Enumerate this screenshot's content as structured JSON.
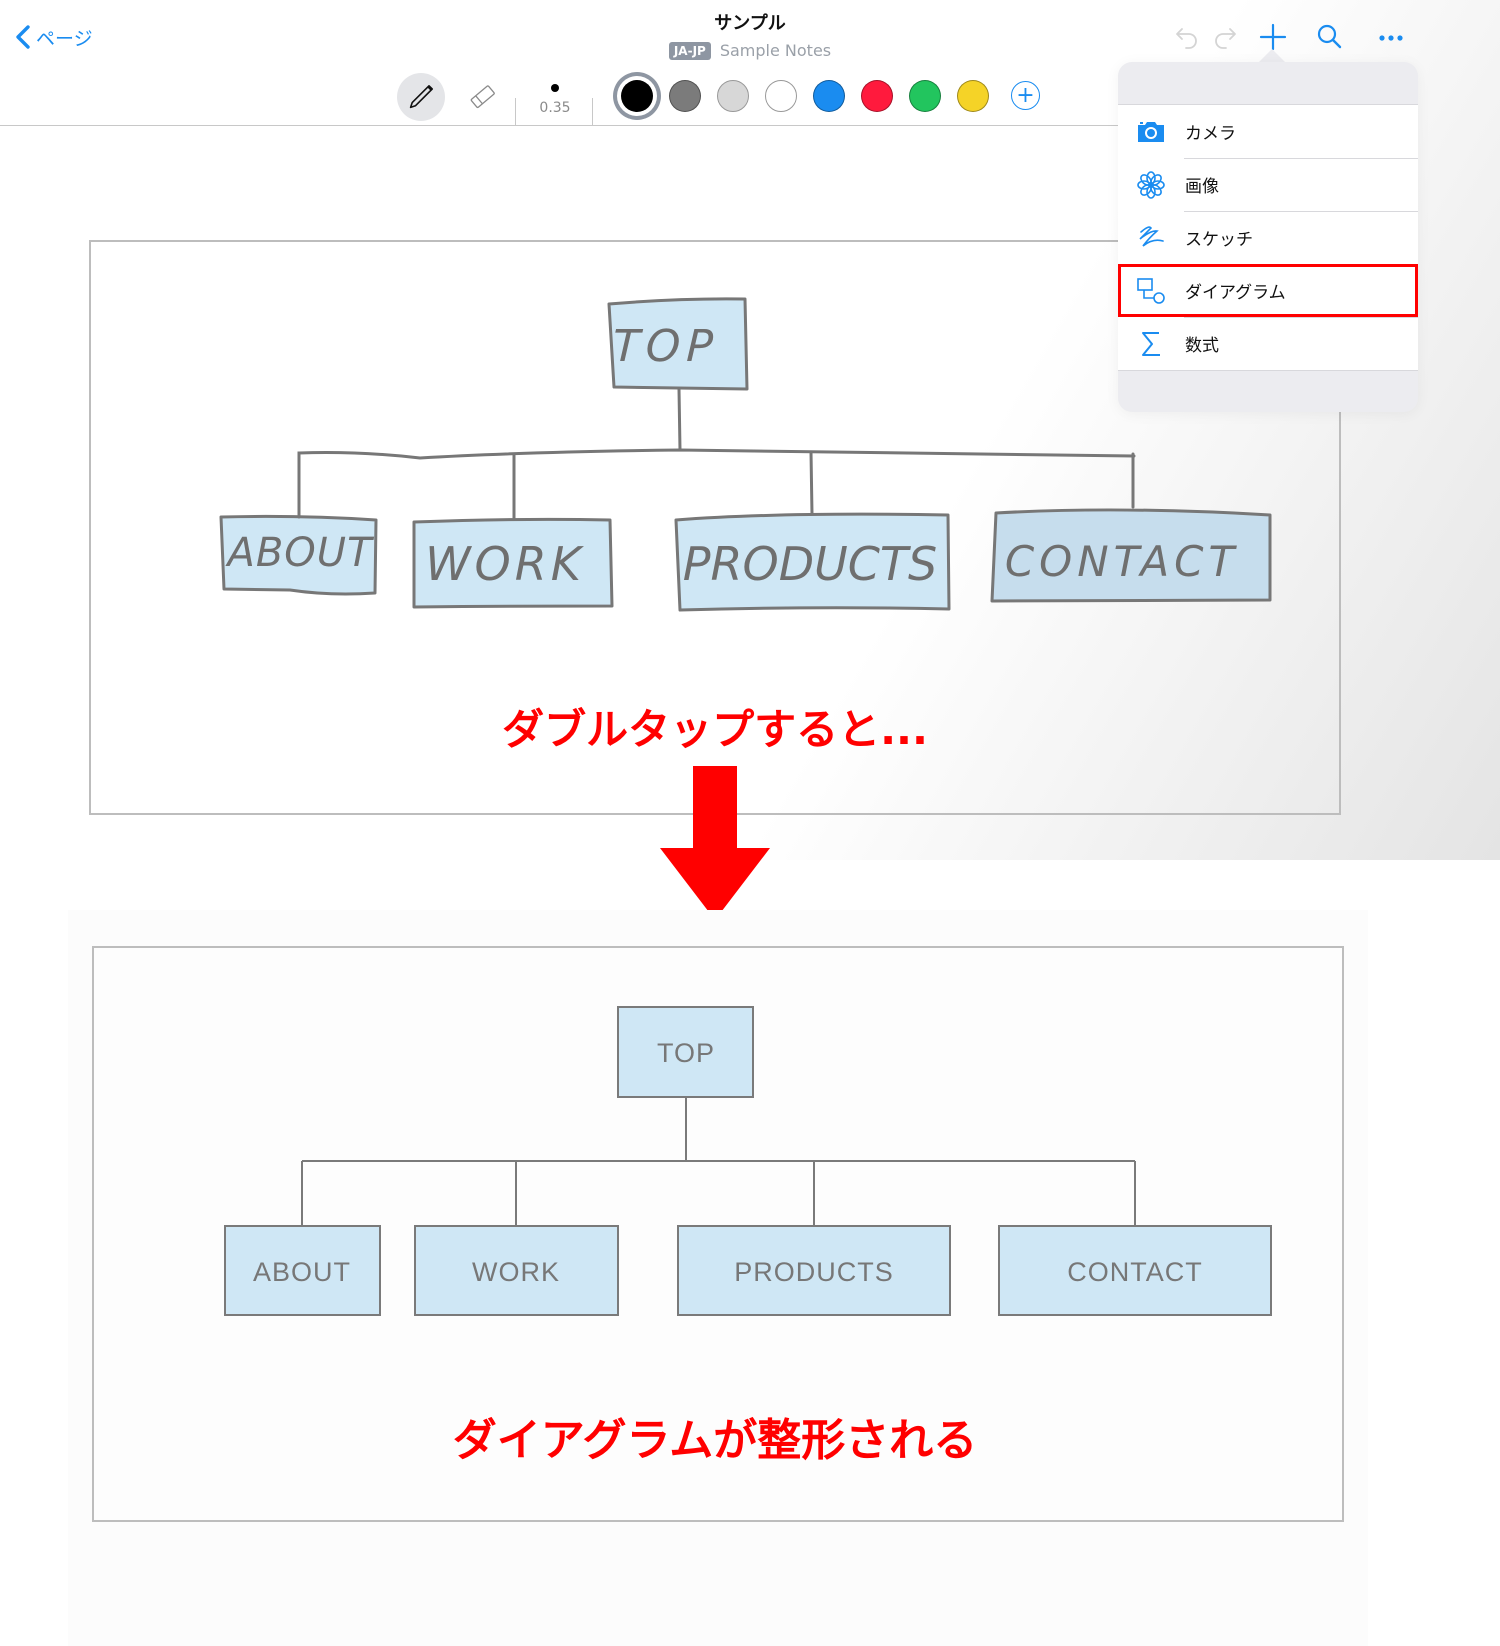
{
  "header": {
    "back_label": "ページ",
    "title": "サンプル",
    "language_badge": "JA-JP",
    "notebook_name": "Sample Notes"
  },
  "top_actions": {
    "undo": "undo-icon",
    "redo": "redo-icon",
    "add": "plus-icon",
    "search": "search-icon",
    "more": "ellipsis-icon"
  },
  "toolbar": {
    "tools": [
      {
        "name": "pencil",
        "icon": "pencil-icon",
        "selected": true
      },
      {
        "name": "eraser",
        "icon": "eraser-icon",
        "selected": false
      }
    ],
    "pen_size": "0.35",
    "colors": [
      {
        "name": "black",
        "hex": "#000000",
        "selected": true
      },
      {
        "name": "gray",
        "hex": "#7b7b7b",
        "selected": false
      },
      {
        "name": "light-gray",
        "hex": "#d7d7d7",
        "selected": false
      },
      {
        "name": "white",
        "hex": "#ffffff",
        "selected": false
      },
      {
        "name": "blue",
        "hex": "#1a8cf0",
        "selected": false
      },
      {
        "name": "red",
        "hex": "#ff1a3d",
        "selected": false
      },
      {
        "name": "green",
        "hex": "#22c55e",
        "selected": false
      },
      {
        "name": "yellow",
        "hex": "#f5d327",
        "selected": false
      }
    ],
    "add_color_label": "+"
  },
  "insert_menu": {
    "items": [
      {
        "label": "カメラ",
        "icon": "camera-icon",
        "highlighted": false
      },
      {
        "label": "画像",
        "icon": "photos-flower-icon",
        "highlighted": false
      },
      {
        "label": "スケッチ",
        "icon": "sketch-squiggle-icon",
        "highlighted": false
      },
      {
        "label": "ダイアグラム",
        "icon": "diagram-shapes-icon",
        "highlighted": true
      },
      {
        "label": "数式",
        "icon": "sigma-icon",
        "highlighted": false
      }
    ]
  },
  "diagram": {
    "root": "TOP",
    "children": [
      "ABOUT",
      "WORK",
      "PRODUCTS",
      "CONTACT"
    ]
  },
  "captions": {
    "before": "ダブルタップすると...",
    "after": "ダイアグラムが整形される"
  },
  "colors": {
    "accent": "#1a8cf0",
    "annotation_red": "#ff0000",
    "node_fill": "#cfe7f5",
    "node_stroke": "#7a7a7a"
  }
}
